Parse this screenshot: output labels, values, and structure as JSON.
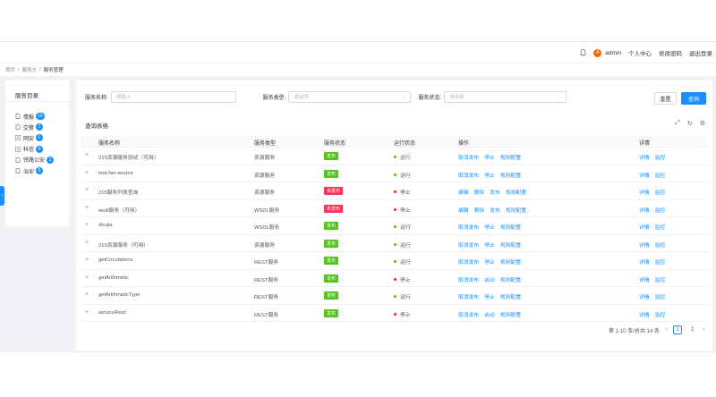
{
  "header": {
    "user": "admin",
    "avatar_letter": "A",
    "links": [
      "个人中心",
      "修改密码",
      "退出登录"
    ]
  },
  "breadcrumb": [
    "首页",
    "服务方",
    "服务管理"
  ],
  "sidebar": {
    "title": "服务目录",
    "items": [
      {
        "label": "情报",
        "count": "10",
        "expand": "file-icon"
      },
      {
        "label": "交警",
        "count": "2",
        "expand": "file-icon"
      },
      {
        "label": "网安",
        "count": "1",
        "expand": "plus-square-icon"
      },
      {
        "label": "科信",
        "count": "0",
        "expand": "plus-square-icon"
      },
      {
        "label": "铁路公安",
        "count": "1",
        "expand": "file-icon"
      },
      {
        "label": "治安",
        "count": "0",
        "expand": "file-icon"
      }
    ]
  },
  "filters": {
    "name_label": "服务名称:",
    "name_placeholder": "请输入",
    "type_label": "服务类型:",
    "type_placeholder": "请选择",
    "status_label": "服务状态:",
    "status_placeholder": "请选择",
    "reset": "重置",
    "query": "查询"
  },
  "table": {
    "title": "查询表格",
    "columns": [
      "服务名称",
      "服务类型",
      "服务状态",
      "运行状态",
      "操作",
      "详情"
    ],
    "rows": [
      {
        "name": "215资源服务测试（可用）",
        "type": "资源服务",
        "status": "发布",
        "run": "运行",
        "ops": [
          "取消发布",
          "停止",
          "规则配置"
        ],
        "details": [
          "详情",
          "监控"
        ]
      },
      {
        "name": "test-fan-source",
        "type": "资源服务",
        "status": "发布",
        "run": "运行",
        "ops": [
          "取消发布",
          "停止",
          "规则配置"
        ],
        "details": [
          "详情",
          "监控"
        ]
      },
      {
        "name": "215服务列表查询",
        "type": "资源服务",
        "status": "未发布",
        "run": "停止",
        "ops": [
          "编辑",
          "删除",
          "发布",
          "规则配置"
        ],
        "details": [
          "详情",
          "监控"
        ]
      },
      {
        "name": "wsdl服务（可用）",
        "type": "WSDL服务",
        "status": "未发布",
        "run": "停止",
        "ops": [
          "编辑",
          "删除",
          "发布",
          "规则配置"
        ],
        "details": [
          "详情",
          "监控"
        ]
      },
      {
        "name": "doujia",
        "type": "WSDL服务",
        "status": "发布",
        "run": "运行",
        "ops": [
          "取消发布",
          "停止",
          "规则配置"
        ],
        "details": [
          "详情",
          "监控"
        ]
      },
      {
        "name": "215资源服务（可用）",
        "type": "资源服务",
        "status": "发布",
        "run": "运行",
        "ops": [
          "取消发布",
          "停止",
          "规则配置"
        ],
        "details": [
          "详情",
          "监控"
        ]
      },
      {
        "name": "getCirculations",
        "type": "REST服务",
        "status": "发布",
        "run": "运行",
        "ops": [
          "取消发布",
          "停止",
          "规则配置"
        ],
        "details": [
          "详情",
          "监控"
        ]
      },
      {
        "name": "getArithmetic",
        "type": "REST服务",
        "status": "发布",
        "run": "停止",
        "ops": [
          "取消发布",
          "启动",
          "规则配置"
        ],
        "details": [
          "详情",
          "监控"
        ]
      },
      {
        "name": "getArithmeticType",
        "type": "REST服务",
        "status": "发布",
        "run": "运行",
        "ops": [
          "取消发布",
          "停止",
          "规则配置"
        ],
        "details": [
          "详情",
          "监控"
        ]
      },
      {
        "name": "serviceRest",
        "type": "REST服务",
        "status": "发布",
        "run": "停止",
        "ops": [
          "取消发布",
          "启动",
          "规则配置"
        ],
        "details": [
          "详情",
          "监控"
        ]
      }
    ]
  },
  "pagination": {
    "summary": "第 1-10 条/总共 14 条",
    "pages": [
      "1",
      "2"
    ],
    "current": "1",
    "prev": "<",
    "next": ">"
  },
  "colors": {
    "primary": "#1890ff",
    "published": "#52c41a",
    "unpublished": "#f5365c",
    "running": "#52c41a",
    "stopped": "#f5222d"
  }
}
